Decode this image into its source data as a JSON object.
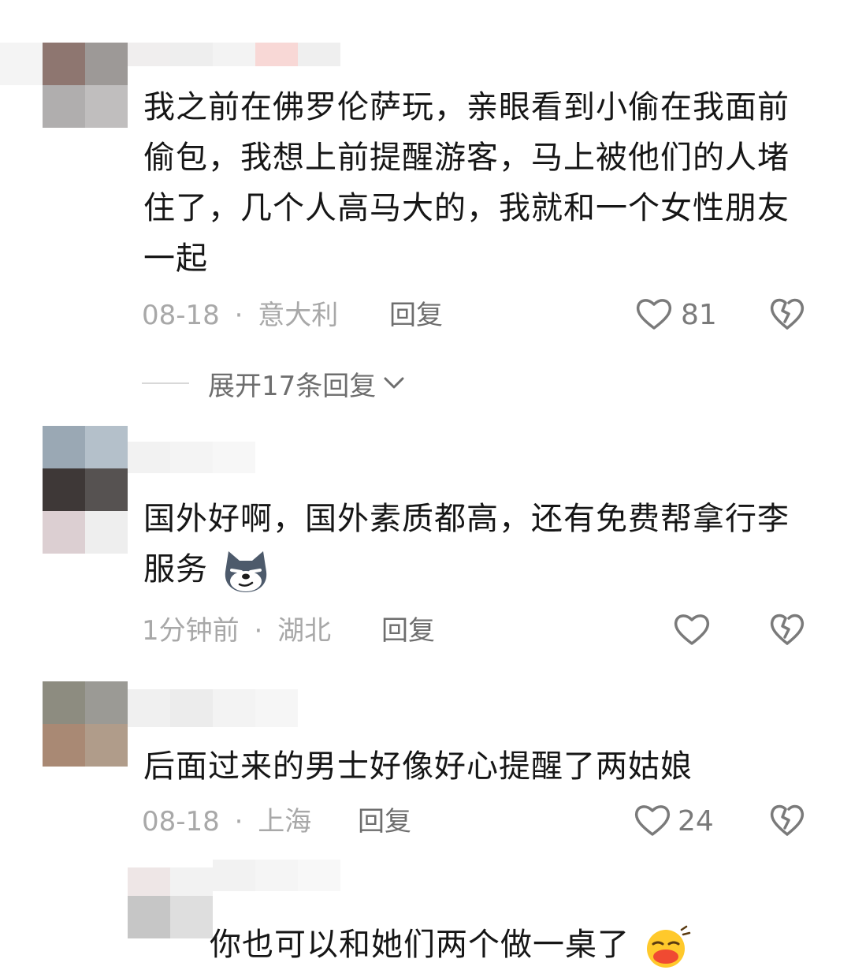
{
  "comments": [
    {
      "text": "我之前在佛罗伦萨玩，亲眼看到小偷在我面前偷包，我想上前提醒游客，马上被他们的人堵住了，几个人高马大的，我就和一个女性朋友一起",
      "date": "08-18",
      "location": "意大利",
      "reply_label": "回复",
      "likes": "81",
      "expand_label": "展开17条回复"
    },
    {
      "text": "国外好啊，国外素质都高，还有免费帮拿行李服务",
      "emoji": "dog-smirk-emoji",
      "date": "1分钟前",
      "location": "湖北",
      "reply_label": "回复",
      "likes": ""
    },
    {
      "text": "后面过来的男士好像好心提醒了两姑娘",
      "date": "08-18",
      "location": "上海",
      "reply_label": "回复",
      "likes": "24"
    },
    {
      "text": "你也可以和她们两个做一桌了",
      "emoji": "laughing-face-emoji"
    }
  ],
  "separator": "·",
  "colors": {
    "text": "#161616",
    "meta": "#a8a8a8",
    "reply": "#6e6e6e",
    "icon": "#7a7a7a"
  }
}
